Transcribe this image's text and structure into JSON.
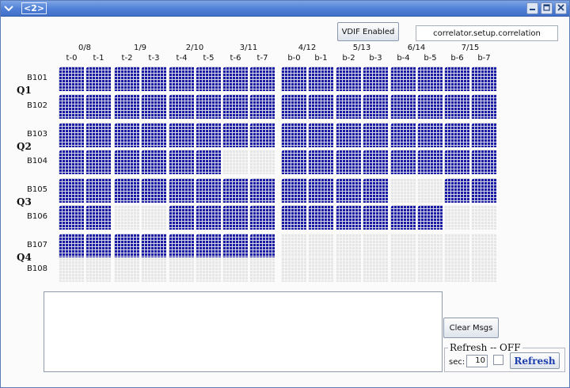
{
  "window": {
    "title": "<2>"
  },
  "toolbar": {
    "vdif_label": "VDIF Enabled",
    "correlator_value": "correlator.setup.correlation"
  },
  "grid": {
    "col_groups": [
      "0/8",
      "1/9",
      "2/10",
      "3/11",
      "4/12",
      "5/13",
      "6/14",
      "7/15"
    ],
    "col_subs": [
      "t-0",
      "t-1",
      "t-2",
      "t-3",
      "t-4",
      "t-5",
      "t-6",
      "t-7",
      "b-0",
      "b-1",
      "b-2",
      "b-3",
      "b-4",
      "b-5",
      "b-6",
      "b-7"
    ],
    "row_labels": [
      "B101",
      "B102",
      "B103",
      "B104",
      "B105",
      "B106",
      "B107",
      "B108"
    ],
    "quadrants": [
      "Q1",
      "Q2",
      "Q3",
      "Q4"
    ],
    "states": [
      "1111111111111111",
      "1111111111111111",
      "1111111111111111",
      "1111110011111111",
      "1111111111110011",
      "1100111111111100",
      "1111111100000000",
      "0000000000000000"
    ],
    "colors": {
      "active": "#1a1aa6",
      "inactive": "#e6e6e6"
    }
  },
  "messages": {
    "clear_label": "Clear Msgs",
    "text": ""
  },
  "refresh": {
    "legend": "Refresh  -- OFF",
    "sec_label": "sec:",
    "sec_value": "10",
    "button_label": "Refresh",
    "checked": false
  }
}
